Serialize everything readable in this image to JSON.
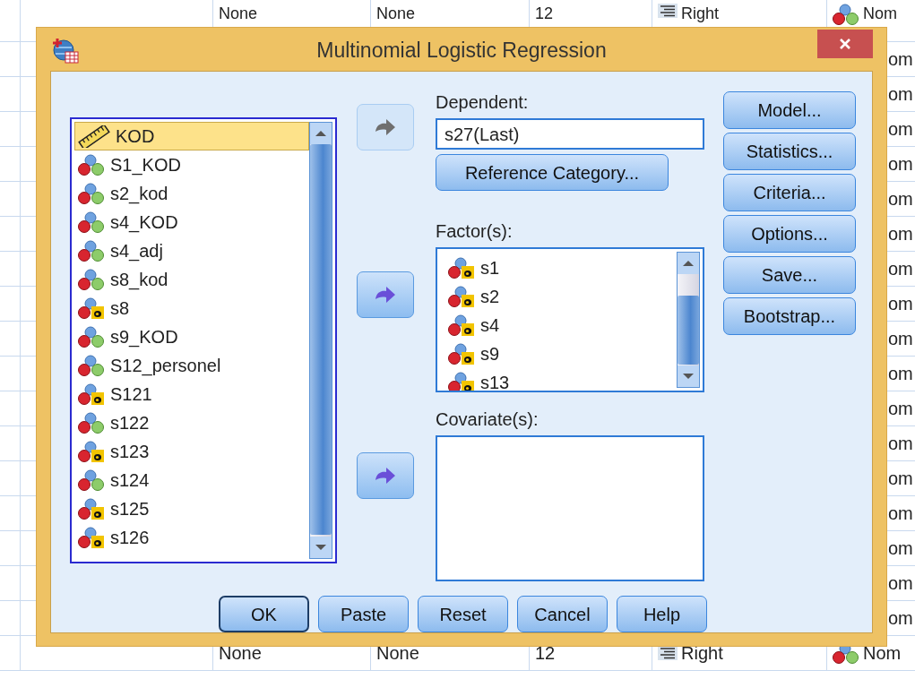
{
  "background_sheet": {
    "rows": [
      {
        "kind": "full",
        "cells": [
          "None",
          "None",
          "12",
          "Right",
          "Nom"
        ]
      },
      {
        "kind": "partial",
        "cells": [
          "om"
        ]
      },
      {
        "kind": "partial",
        "cells": [
          "om"
        ]
      },
      {
        "kind": "partial",
        "cells": [
          "om"
        ]
      },
      {
        "kind": "partial",
        "cells": [
          "om"
        ]
      },
      {
        "kind": "partial",
        "cells": [
          "om"
        ]
      },
      {
        "kind": "partial",
        "cells": [
          "om"
        ]
      },
      {
        "kind": "partial",
        "cells": [
          "om"
        ]
      },
      {
        "kind": "partial",
        "cells": [
          "om"
        ]
      },
      {
        "kind": "partial",
        "cells": [
          "om"
        ]
      },
      {
        "kind": "partial",
        "cells": [
          "om"
        ]
      },
      {
        "kind": "partial",
        "cells": [
          "om"
        ]
      },
      {
        "kind": "partial",
        "cells": [
          "om"
        ]
      },
      {
        "kind": "partial",
        "cells": [
          "om"
        ]
      },
      {
        "kind": "partial",
        "cells": [
          "om"
        ]
      },
      {
        "kind": "partial",
        "cells": [
          "om"
        ]
      },
      {
        "kind": "partial",
        "cells": [
          "om"
        ]
      },
      {
        "kind": "partial",
        "cells": [
          "om"
        ]
      },
      {
        "kind": "full",
        "cells": [
          "None",
          "None",
          "12",
          "Right",
          "Nom"
        ]
      }
    ]
  },
  "dialog": {
    "title": "Multinomial Logistic Regression"
  },
  "variables": [
    {
      "name": "KOD",
      "kind": "scale",
      "selected": true
    },
    {
      "name": "S1_KOD",
      "kind": "nominal",
      "selected": false
    },
    {
      "name": "s2_kod",
      "kind": "nominal",
      "selected": false
    },
    {
      "name": "s4_KOD",
      "kind": "nominal",
      "selected": false
    },
    {
      "name": "s4_adj",
      "kind": "nominal",
      "selected": false
    },
    {
      "name": "s8_kod",
      "kind": "nominal",
      "selected": false
    },
    {
      "name": "s8",
      "kind": "string",
      "selected": false
    },
    {
      "name": "s9_KOD",
      "kind": "nominal",
      "selected": false
    },
    {
      "name": "S12_personel",
      "kind": "nominal",
      "selected": false
    },
    {
      "name": "S121",
      "kind": "string",
      "selected": false
    },
    {
      "name": "s122",
      "kind": "nominal",
      "selected": false
    },
    {
      "name": "s123",
      "kind": "string",
      "selected": false
    },
    {
      "name": "s124",
      "kind": "nominal",
      "selected": false
    },
    {
      "name": "s125",
      "kind": "string",
      "selected": false
    },
    {
      "name": "s126",
      "kind": "string",
      "selected": false
    }
  ],
  "transfer_buttons": [
    {
      "disabled": true
    },
    {
      "disabled": false
    },
    {
      "disabled": false
    }
  ],
  "dependent": {
    "label": "Dependent:",
    "value": "s27(Last)"
  },
  "reference_button": {
    "label": "Reference Category..."
  },
  "factors": {
    "label": "Factor(s):",
    "items": [
      {
        "name": "s1",
        "kind": "string",
        "selected": false
      },
      {
        "name": "s2",
        "kind": "string",
        "selected": false
      },
      {
        "name": "s4",
        "kind": "string",
        "selected": false
      },
      {
        "name": "s9",
        "kind": "string",
        "selected": false
      },
      {
        "name": "s13",
        "kind": "string",
        "selected": false
      }
    ]
  },
  "covariates": {
    "label": "Covariate(s):"
  },
  "side_buttons": [
    {
      "label": "Model..."
    },
    {
      "label": "Statistics..."
    },
    {
      "label": "Criteria..."
    },
    {
      "label": "Options..."
    },
    {
      "label": "Save..."
    },
    {
      "label": "Bootstrap..."
    }
  ],
  "footer_buttons": [
    {
      "label": "OK",
      "default": true
    },
    {
      "label": "Paste",
      "default": false
    },
    {
      "label": "Reset",
      "default": false
    },
    {
      "label": "Cancel",
      "default": false
    },
    {
      "label": "Help",
      "default": false
    }
  ]
}
